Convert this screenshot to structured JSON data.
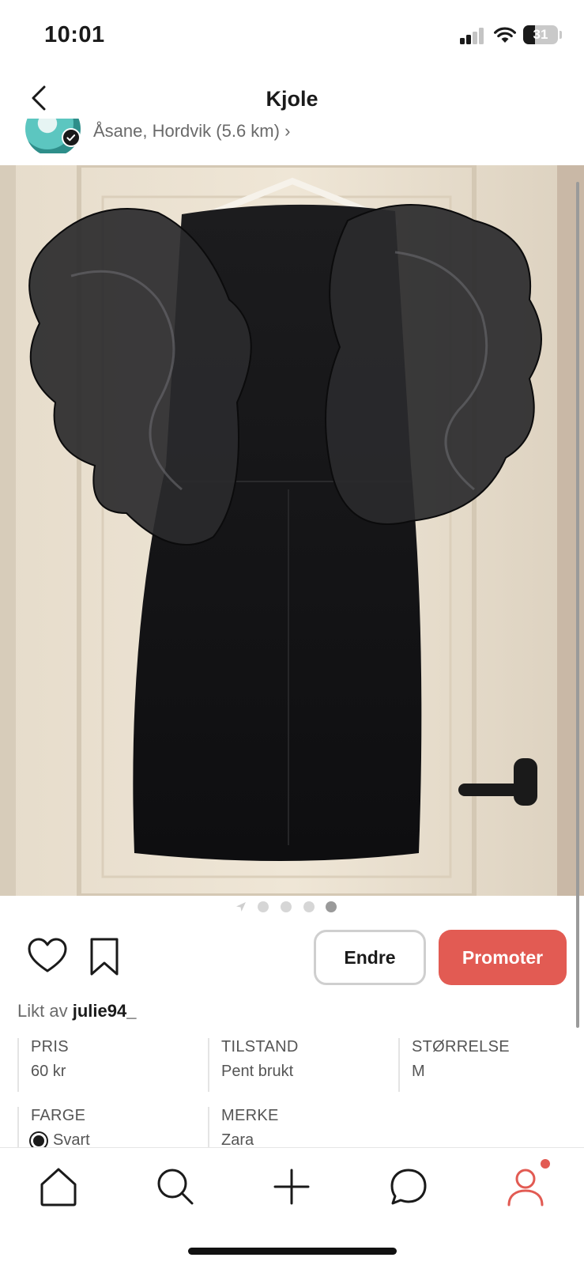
{
  "status_bar": {
    "time": "10:01",
    "battery": "31"
  },
  "header": {
    "title": "Kjole"
  },
  "seller": {
    "location": "Åsane, Hordvik (5.6 km) ›"
  },
  "photo": {
    "description_icon": "dress-photo",
    "page_count": 4,
    "active_page": 4
  },
  "actions": {
    "edit_label": "Endre",
    "promote_label": "Promoter"
  },
  "likes": {
    "prefix": "Likt av",
    "user": "julie94_"
  },
  "details": [
    {
      "label": "PRIS",
      "value": "60 kr"
    },
    {
      "label": "TILSTAND",
      "value": "Pent brukt"
    },
    {
      "label": "STØRRELSE",
      "value": "M"
    },
    {
      "label": "FARGE",
      "value": "Svart"
    },
    {
      "label": "MERKE",
      "value": "Zara"
    }
  ],
  "colors": {
    "accent": "#e25b53",
    "text": "#1a1a1a",
    "muted": "#6a6a6a"
  },
  "tabbar": {
    "items": [
      "home-icon",
      "search-icon",
      "plus-icon",
      "chat-icon",
      "profile-icon"
    ],
    "active": "profile-icon"
  }
}
